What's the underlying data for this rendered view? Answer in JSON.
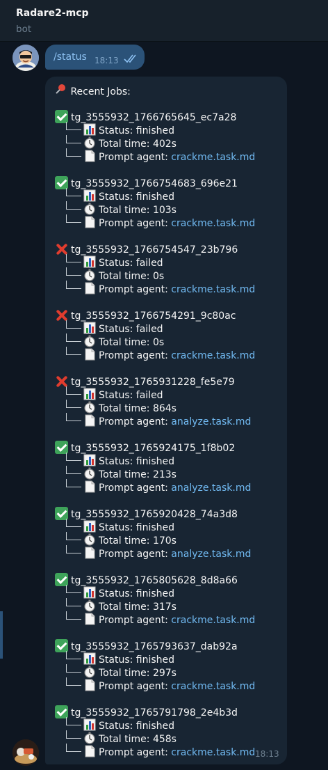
{
  "header": {
    "title": "Radare2-mcp",
    "subtitle": "bot"
  },
  "outgoing": {
    "command": "/status",
    "time": "18:13"
  },
  "incoming": {
    "heading": "Recent Jobs:",
    "time": "18:13",
    "labels": {
      "status": "Status: ",
      "total_time": "Total time: ",
      "prompt_agent": "Prompt agent: "
    },
    "jobs": [
      {
        "id": "tg_3555932_1766765645_ec7a28",
        "state": "ok",
        "status": "finished",
        "time": "402s",
        "agent": "crackme.task.md"
      },
      {
        "id": "tg_3555932_1766754683_696e21",
        "state": "ok",
        "status": "finished",
        "time": "103s",
        "agent": "crackme.task.md"
      },
      {
        "id": "tg_3555932_1766754547_23b796",
        "state": "fail",
        "status": "failed",
        "time": "0s",
        "agent": "crackme.task.md"
      },
      {
        "id": "tg_3555932_1766754291_9c80ac",
        "state": "fail",
        "status": "failed",
        "time": "0s",
        "agent": "crackme.task.md"
      },
      {
        "id": "tg_3555932_1765931228_fe5e79",
        "state": "fail",
        "status": "failed",
        "time": "864s",
        "agent": "analyze.task.md"
      },
      {
        "id": "tg_3555932_1765924175_1f8b02",
        "state": "ok",
        "status": "finished",
        "time": "213s",
        "agent": "analyze.task.md"
      },
      {
        "id": "tg_3555932_1765920428_74a3d8",
        "state": "ok",
        "status": "finished",
        "time": "170s",
        "agent": "analyze.task.md"
      },
      {
        "id": "tg_3555932_1765805628_8d8a66",
        "state": "ok",
        "status": "finished",
        "time": "317s",
        "agent": "crackme.task.md"
      },
      {
        "id": "tg_3555932_1765793637_dab92a",
        "state": "ok",
        "status": "finished",
        "time": "297s",
        "agent": "crackme.task.md"
      },
      {
        "id": "tg_3555932_1765791798_2e4b3d",
        "state": "ok",
        "status": "finished",
        "time": "458s",
        "agent": "crackme.task.md"
      }
    ]
  },
  "icons": {
    "pin": "pushpin-icon",
    "ok": "check-mark-icon",
    "fail": "cross-mark-icon",
    "status": "bar-chart-icon",
    "time": "stopwatch-icon",
    "agent": "document-icon"
  },
  "colors": {
    "link": "#71baf2",
    "outgoing_bubble": "#2b5278",
    "incoming_bubble": "#182533",
    "background": "#0e1621"
  }
}
